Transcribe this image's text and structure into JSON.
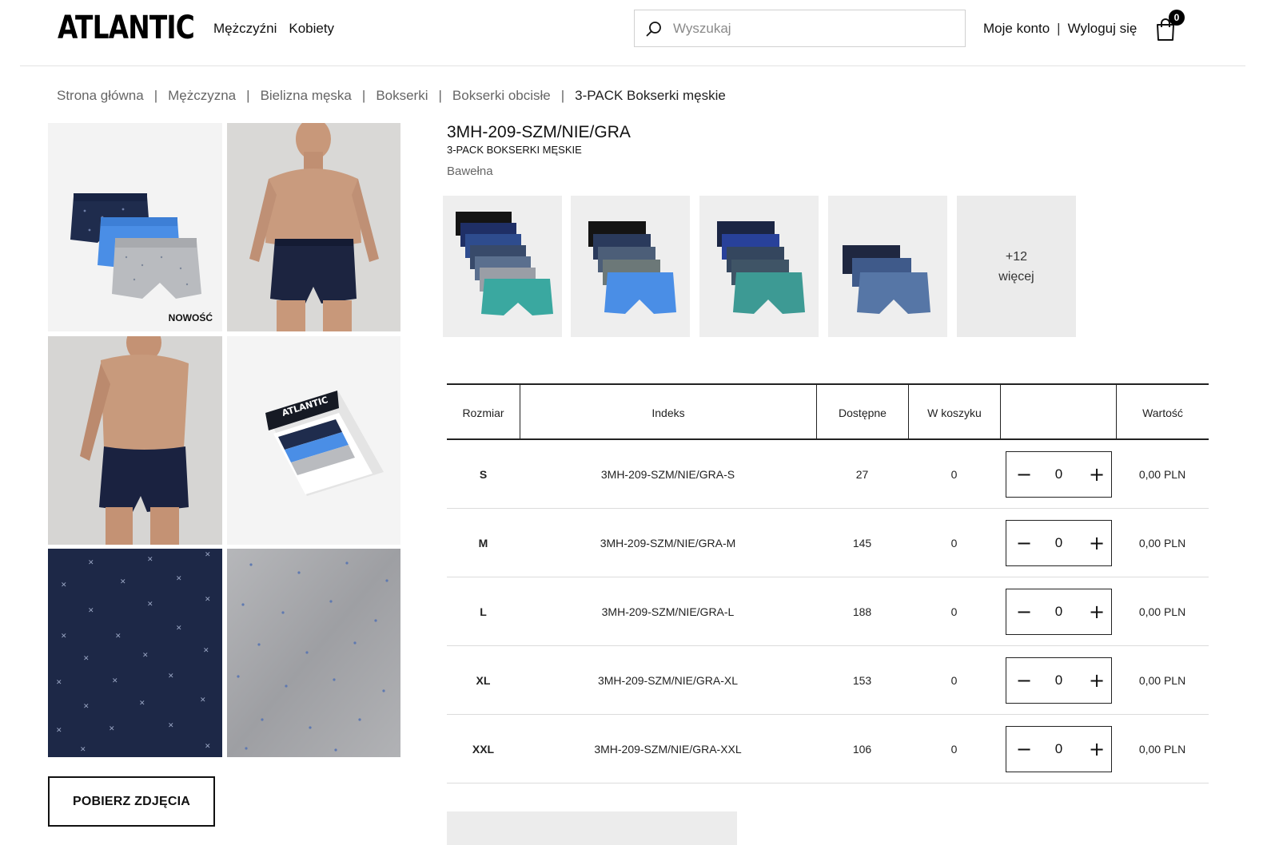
{
  "header": {
    "logo": "ATLANTIC",
    "nav": [
      "Mężczyźni",
      "Kobiety"
    ],
    "search_placeholder": "Wyszukaj",
    "account_label": "Moje konto",
    "logout_label": "Wyloguj się",
    "cart_count": "0"
  },
  "breadcrumb": [
    "Strona główna",
    "Mężczyzna",
    "Bielizna męska",
    "Bokserki",
    "Bokserki obcisłe",
    "3-PACK Bokserki męskie"
  ],
  "gallery": {
    "badge": "NOWOŚĆ",
    "box_brand": "ATLANTIC",
    "download_label": "POBIERZ ZDJĘCIA"
  },
  "product": {
    "sku": "3MH-209-SZM/NIE/GRA",
    "name": "3-PACK BOKSERKI MĘSKIE",
    "material": "Bawełna"
  },
  "variants": {
    "more_count": "+12",
    "more_label": "więcej"
  },
  "table": {
    "headers": {
      "size": "Rozmiar",
      "index": "Indeks",
      "available": "Dostępne",
      "in_cart": "W koszyku",
      "quantity": "",
      "value": "Wartość"
    },
    "rows": [
      {
        "size": "S",
        "index": "3MH-209-SZM/NIE/GRA-S",
        "available": "27",
        "in_cart": "0",
        "qty": "0",
        "value": "0,00 PLN"
      },
      {
        "size": "M",
        "index": "3MH-209-SZM/NIE/GRA-M",
        "available": "145",
        "in_cart": "0",
        "qty": "0",
        "value": "0,00 PLN"
      },
      {
        "size": "L",
        "index": "3MH-209-SZM/NIE/GRA-L",
        "available": "188",
        "in_cart": "0",
        "qty": "0",
        "value": "0,00 PLN"
      },
      {
        "size": "XL",
        "index": "3MH-209-SZM/NIE/GRA-XL",
        "available": "153",
        "in_cart": "0",
        "qty": "0",
        "value": "0,00 PLN"
      },
      {
        "size": "XXL",
        "index": "3MH-209-SZM/NIE/GRA-XXL",
        "available": "106",
        "in_cart": "0",
        "qty": "0",
        "value": "0,00 PLN"
      }
    ],
    "minus_symbol": "−",
    "plus_symbol": "+"
  }
}
